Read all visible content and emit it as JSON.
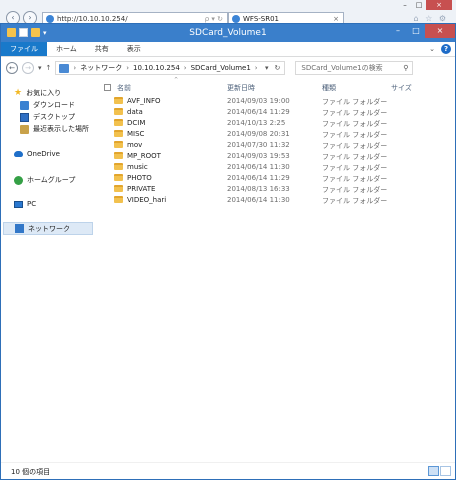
{
  "browser": {
    "address": "http://10.10.10.254/",
    "address_search_glyphs": "ρ ▾ ↻",
    "tab_title": "WFS-SR01",
    "tab_close": "×",
    "window_buttons": [
      "–",
      "□",
      "×"
    ],
    "right_icons": "⌂ ☆ ⚙"
  },
  "explorer": {
    "title": "SDCard_Volume1",
    "window_buttons": {
      "minimize": "–",
      "maximize": "□",
      "close": "×"
    },
    "ribbon": {
      "tabs": [
        "ファイル",
        "ホーム",
        "共有",
        "表示"
      ],
      "expand": "⌄",
      "help": "?"
    },
    "address_bar": {
      "back": "←",
      "forward": "→",
      "recent": "▾",
      "up": "↑",
      "breadcrumbs": [
        "ネットワーク",
        "10.10.10.254",
        "SDCard_Volume1"
      ],
      "separator": "›",
      "dropdown": "▾",
      "refresh": "↻"
    },
    "search": {
      "placeholder": "SDCard_Volume1の検索",
      "icon": "search-icon"
    },
    "nav": {
      "favorites": "お気に入り",
      "favorites_items": [
        "ダウンロード",
        "デスクトップ",
        "最近表示した場所"
      ],
      "onedrive": "OneDrive",
      "homegroup": "ホームグループ",
      "pc": "PC",
      "network": "ネットワーク"
    },
    "columns": {
      "name": "名前",
      "date": "更新日時",
      "type": "種類",
      "size": "サイズ"
    },
    "files": [
      {
        "name": "AVF_INFO",
        "date": "2014/09/03 19:00",
        "type": "ファイル フォルダー"
      },
      {
        "name": "data",
        "date": "2014/06/14 11:29",
        "type": "ファイル フォルダー"
      },
      {
        "name": "DCIM",
        "date": "2014/10/13 2:25",
        "type": "ファイル フォルダー"
      },
      {
        "name": "MISC",
        "date": "2014/09/08 20:31",
        "type": "ファイル フォルダー"
      },
      {
        "name": "mov",
        "date": "2014/07/30 11:32",
        "type": "ファイル フォルダー"
      },
      {
        "name": "MP_ROOT",
        "date": "2014/09/03 19:53",
        "type": "ファイル フォルダー"
      },
      {
        "name": "music",
        "date": "2014/06/14 11:30",
        "type": "ファイル フォルダー"
      },
      {
        "name": "PHOTO",
        "date": "2014/06/14 11:29",
        "type": "ファイル フォルダー"
      },
      {
        "name": "PRIVATE",
        "date": "2014/08/13 16:33",
        "type": "ファイル フォルダー"
      },
      {
        "name": "VIDEO_hari",
        "date": "2014/06/14 11:30",
        "type": "ファイル フォルダー"
      }
    ],
    "status": "10 個の項目"
  },
  "colors": {
    "titlebar": "#3a7fcb",
    "file_tab": "#1979ca",
    "selection": "#dde9f6",
    "close": "#c75050",
    "folder": "#f2c14e"
  }
}
